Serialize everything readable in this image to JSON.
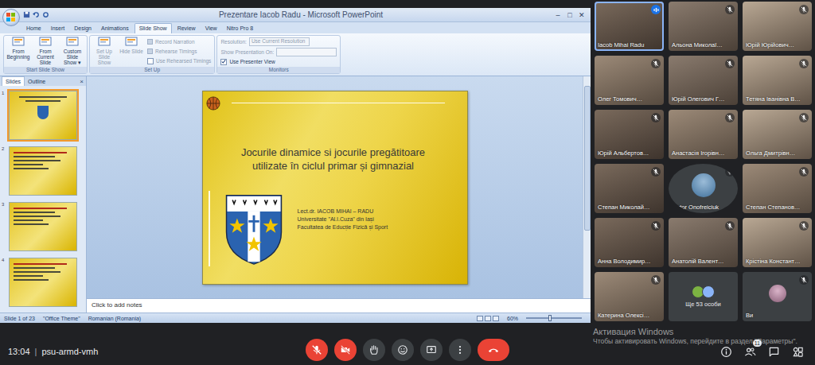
{
  "meeting": {
    "time": "13:04",
    "separator": "|",
    "code": "psu-armd-vmh"
  },
  "controls": [
    {
      "kind": "mic",
      "danger": true
    },
    {
      "kind": "camera",
      "danger": true
    },
    {
      "kind": "hand",
      "danger": false
    },
    {
      "kind": "emoji",
      "danger": false
    },
    {
      "kind": "present",
      "danger": false
    },
    {
      "kind": "more",
      "danger": false
    },
    {
      "kind": "end",
      "danger": true
    }
  ],
  "side_buttons": [
    {
      "kind": "info",
      "badge": ""
    },
    {
      "kind": "people",
      "badge": "11"
    },
    {
      "kind": "chat",
      "badge": ""
    },
    {
      "kind": "activities",
      "badge": ""
    }
  ],
  "watermark": {
    "title": "Активация Windows",
    "text": "Чтобы активировать Windows, перейдите в раздел \"Параметры\"."
  },
  "ppt": {
    "title": "Prezentare Iacob Radu - Microsoft PowerPoint",
    "window_buttons": [
      "–",
      "□",
      "✕"
    ],
    "tabs": [
      {
        "label": "Home",
        "selected": false
      },
      {
        "label": "Insert",
        "selected": false
      },
      {
        "label": "Design",
        "selected": false
      },
      {
        "label": "Animations",
        "selected": false
      },
      {
        "label": "Slide Show",
        "selected": true
      },
      {
        "label": "Review",
        "selected": false
      },
      {
        "label": "View",
        "selected": false
      },
      {
        "label": "Nitro Pro 8",
        "selected": false
      }
    ],
    "groups": [
      {
        "label": "Start Slide Show",
        "items": [
          {
            "kind": "big",
            "label": "From Beginning",
            "value": "",
            "disabled": false,
            "checked": false
          },
          {
            "kind": "big",
            "label": "From Current Slide",
            "value": "",
            "disabled": false,
            "checked": false
          },
          {
            "kind": "big",
            "label": "Custom Slide Show ▾",
            "value": "",
            "disabled": false,
            "checked": false
          }
        ]
      },
      {
        "label": "Set Up",
        "items": [
          {
            "kind": "big",
            "label": "Set Up Slide Show",
            "value": "",
            "disabled": true,
            "checked": false
          },
          {
            "kind": "big",
            "label": "Hide Slide",
            "value": "",
            "disabled": true,
            "checked": false
          },
          {
            "kind": "small",
            "label": "Record Narration",
            "value": "",
            "disabled": true,
            "checked": false
          },
          {
            "kind": "small",
            "label": "Rehearse Timings",
            "value": "",
            "disabled": true,
            "checked": false
          },
          {
            "kind": "check",
            "label": "Use Rehearsed Timings",
            "value": "",
            "disabled": true,
            "checked": false
          }
        ]
      },
      {
        "label": "Monitors",
        "items": [
          {
            "kind": "combo",
            "label": "Resolution:",
            "value": "Use Current Resolution",
            "disabled": true,
            "checked": false
          },
          {
            "kind": "combo",
            "label": "Show Presentation On:",
            "value": "",
            "disabled": true,
            "checked": false
          },
          {
            "kind": "check",
            "label": "Use Presenter View",
            "value": "",
            "disabled": false,
            "checked": true
          }
        ]
      }
    ],
    "pane_tabs": [
      {
        "label": "Slides",
        "selected": true
      },
      {
        "label": "Outline",
        "selected": false
      }
    ],
    "pane_close": "×",
    "thumbnails": [
      {
        "number": "1",
        "kind": "title",
        "selected": true
      },
      {
        "number": "2",
        "kind": "text",
        "selected": false
      },
      {
        "number": "3",
        "kind": "text",
        "selected": false
      },
      {
        "number": "4",
        "kind": "text",
        "selected": false
      }
    ],
    "slide": {
      "title": "Jocurile dinamice si jocurile pregătitoare utilizate în ciclul primar și gimnazial",
      "author": [
        "Lect.dr. IACOB MIHAI – RADU",
        "Universitate \"Al.I.Cuza\" din Iași",
        "Facultatea de Educție Fizică și Sport"
      ]
    },
    "notes": "Click to add notes",
    "status": {
      "items": [
        "Slide 1 of 23",
        "\"Office Theme\"",
        "Romanian (Romania)"
      ],
      "zoom": "60%",
      "zoom_level": 0.4
    }
  },
  "participants": [
    {
      "name": "Iacob Mihai Radu",
      "kind": "video",
      "muted": false,
      "speaking": true
    },
    {
      "name": "Альона Миколаї…",
      "kind": "video",
      "muted": true,
      "speaking": false
    },
    {
      "name": "Юрій Юрійович…",
      "kind": "video",
      "muted": true,
      "speaking": false
    },
    {
      "name": "Олег Томович…",
      "kind": "video",
      "muted": true,
      "speaking": false
    },
    {
      "name": "Юрій Олегович Г…",
      "kind": "video",
      "muted": true,
      "speaking": false
    },
    {
      "name": "Тетяна Іванівна В…",
      "kind": "video",
      "muted": true,
      "speaking": false
    },
    {
      "name": "Юрій Альбертов…",
      "kind": "video",
      "muted": true,
      "speaking": false
    },
    {
      "name": "Анастасія Ігорівн…",
      "kind": "video",
      "muted": true,
      "speaking": false
    },
    {
      "name": "Ольга Дмитрівн…",
      "kind": "video",
      "muted": true,
      "speaking": false
    },
    {
      "name": "Степан Миколай…",
      "kind": "video",
      "muted": true,
      "speaking": false
    },
    {
      "name": "Victor Onofreiciuk",
      "kind": "avatar",
      "muted": true,
      "speaking": false
    },
    {
      "name": "Степан Степанов…",
      "kind": "video",
      "muted": true,
      "speaking": false
    },
    {
      "name": "Анна Володимир…",
      "kind": "video",
      "muted": true,
      "speaking": false
    },
    {
      "name": "Анатолій Валент…",
      "kind": "video",
      "muted": true,
      "speaking": false
    },
    {
      "name": "Крістіна Констант…",
      "kind": "video",
      "muted": true,
      "speaking": false
    },
    {
      "name": "Катерина Олексі…",
      "kind": "video",
      "muted": true,
      "speaking": false
    },
    {
      "name": "Ще 53 особи",
      "kind": "more",
      "muted": false,
      "speaking": false
    },
    {
      "name": "Ви",
      "kind": "self",
      "muted": true,
      "speaking": false
    }
  ]
}
